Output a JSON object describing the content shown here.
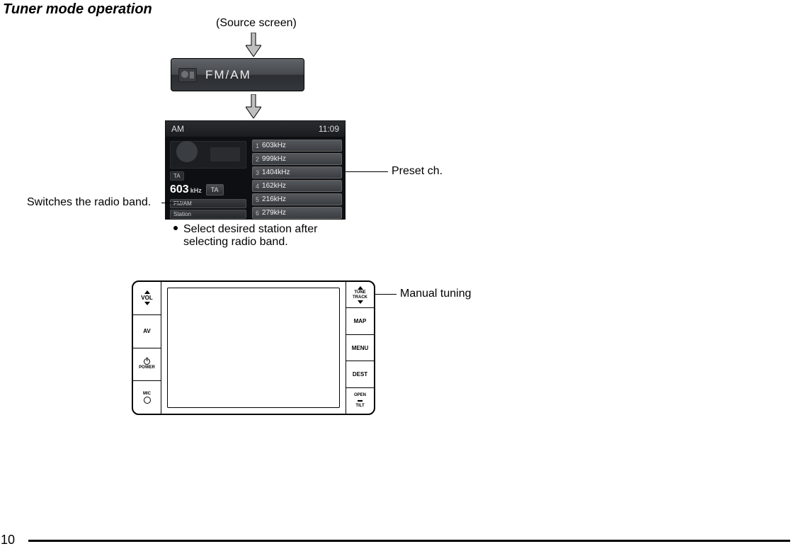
{
  "title": "Tuner mode operation",
  "source_screen_label": "(Source screen)",
  "fmam_button_label": "FM/AM",
  "tuner": {
    "band": "AM",
    "clock": "11:09",
    "ta_indicator": "TA",
    "current_freq_value": "603",
    "current_freq_unit": "kHz",
    "ta_button": "TA",
    "left_chip_fmam": "FM/AM",
    "left_chip_station": "Station",
    "presets": [
      {
        "num": "1",
        "label": "603kHz"
      },
      {
        "num": "2",
        "label": "999kHz"
      },
      {
        "num": "3",
        "label": "1404kHz"
      },
      {
        "num": "4",
        "label": "162kHz"
      },
      {
        "num": "5",
        "label": "216kHz"
      },
      {
        "num": "6",
        "label": "279kHz"
      }
    ]
  },
  "callouts": {
    "preset_ch": "Preset ch.",
    "switch_band": "Switches the radio band.",
    "bullet_line1": "Select desired station after",
    "bullet_line2": "selecting radio band.",
    "manual_tuning": "Manual tuning"
  },
  "headunit": {
    "vol": "VOL",
    "av": "AV",
    "power": "POWER",
    "mic": "MIC",
    "tune": "TUNE",
    "track": "TRACK",
    "map": "MAP",
    "menu": "MENU",
    "dest": "DEST",
    "open": "OPEN",
    "tilt": "TILT"
  },
  "page_number": "10"
}
